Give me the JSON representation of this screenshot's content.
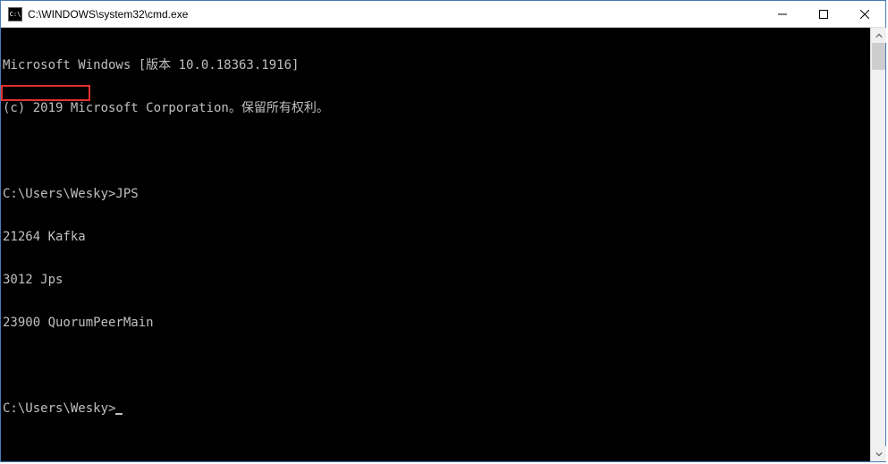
{
  "window": {
    "title": "C:\\WINDOWS\\system32\\cmd.exe",
    "icon_label": "C:\\"
  },
  "terminal": {
    "lines": [
      "Microsoft Windows [版本 10.0.18363.1916]",
      "(c) 2019 Microsoft Corporation。保留所有权利。",
      "",
      "C:\\Users\\Wesky>JPS",
      "21264 Kafka",
      "3012 Jps",
      "23900 QuorumPeerMain",
      "",
      "C:\\Users\\Wesky>"
    ],
    "highlight_box": {
      "top_line": 4,
      "text": "21264 Kafka"
    }
  }
}
